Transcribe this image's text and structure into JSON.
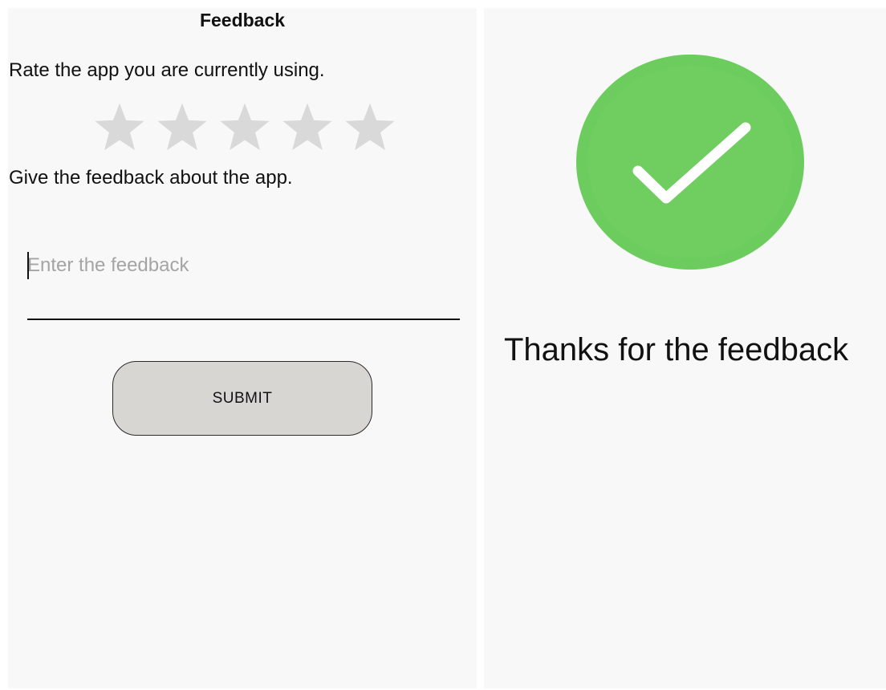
{
  "feedback_screen": {
    "title": "Feedback",
    "rate_prompt": "Rate the app you are currently using.",
    "rating": {
      "max_stars": 5,
      "selected": 0,
      "star_color": "#d9d9d9"
    },
    "feedback_prompt": "Give the feedback about the app.",
    "feedback_input": {
      "value": "",
      "placeholder": "Enter the feedback"
    },
    "submit_label": "SUBMIT"
  },
  "confirmation_screen": {
    "icon": "check-circle-icon",
    "circle_color": "#6ccc5e",
    "check_color": "#ffffff",
    "message": "Thanks for the feedback"
  }
}
